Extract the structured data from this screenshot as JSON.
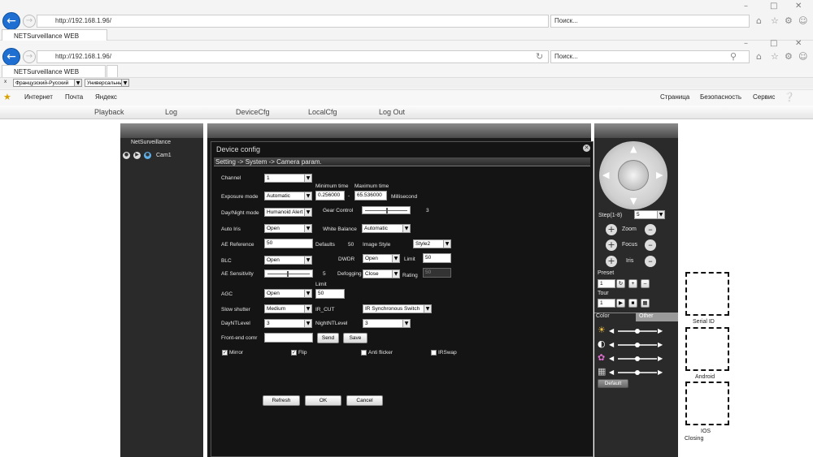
{
  "browser": {
    "url": "http://192.168.1.96/",
    "search_placeholder": "Поиск...",
    "tab_title": "NETSurveillance WEB",
    "tab_title_back": "NETSurveillance WEB",
    "lang_from": "Французский-Русский",
    "lang_to": "Универсальный",
    "favorites": [
      "Интернет",
      "Почта",
      "Яндекс"
    ],
    "toolbar": [
      "Страница",
      "Безопасность",
      "Сервис"
    ]
  },
  "menu": [
    "Playback",
    "Log",
    "DeviceCfg",
    "LocalCfg",
    "Log Out"
  ],
  "left": {
    "title": "NetSurveillance",
    "cam": "Cam1"
  },
  "dialog": {
    "title": "Device config",
    "breadcrumb": "Setting -> System -> Camera param.",
    "channel_label": "Channel",
    "channel": "1",
    "min_time_label": "Minimum time",
    "max_time_label": "Maximum time",
    "exposure_label": "Exposure mode",
    "exposure": "Automatic",
    "min_time": "0.256000",
    "dash": "-",
    "max_time": "65.536000",
    "ms": "Millisecond",
    "daynight_label": "Day/Night mode",
    "daynight": "Humanoid Alert",
    "gear_label": "Gear Control",
    "gear_value": "3",
    "autoiris_label": "Auto Iris",
    "autoiris": "Open",
    "wb_label": "White Balance",
    "wb": "Automatic",
    "aeref_label": "AE Reference",
    "aeref": "50",
    "defaults_label": "Defaults",
    "defaults": "50",
    "imgstyle_label": "Image Style",
    "imgstyle": "Style2",
    "blc_label": "BLC",
    "blc": "Open",
    "dwdr_label": "DWDR",
    "dwdr": "Open",
    "limit_label": "Limit",
    "limit": "50",
    "aesens_label": "AE Sensitivity",
    "aesens": "5",
    "defog_label": "Defogging",
    "defog": "Close",
    "rating_label": "Rating",
    "rating": "50",
    "agc_limit_label": "Limit",
    "agc_label": "AGC",
    "agc": "Open",
    "agc_limit": "50",
    "shutter_label": "Slow shutter",
    "shutter": "Medium",
    "ircut_label": "IR_CUT",
    "ircut": "IR Synchronous Switch",
    "daynt_label": "DayNTLevel",
    "daynt": "3",
    "nightnt_label": "NightNTLevel",
    "nightnt": "3",
    "frontend_label": "Front-end comr",
    "frontend": "",
    "send": "Send",
    "save": "Save",
    "mirror": "Mirror",
    "flip": "Flip",
    "antiflicker": "Anti flicker",
    "irswap": "IRSwap",
    "refresh": "Refresh",
    "ok": "OK",
    "cancel": "Cancel"
  },
  "ptz": {
    "step_label": "Step(1-8)",
    "step": "5",
    "zoom": "Zoom",
    "focus": "Focus",
    "iris": "Iris",
    "preset": "Preset",
    "preset_val": "1",
    "tour": "Tour",
    "tour_val": "1",
    "color_tab": "Color",
    "other_tab": "Other",
    "default": "Default"
  },
  "qr": {
    "serial": "Serial ID",
    "android": "Android",
    "ios": "IOS",
    "closing": "Closing"
  }
}
